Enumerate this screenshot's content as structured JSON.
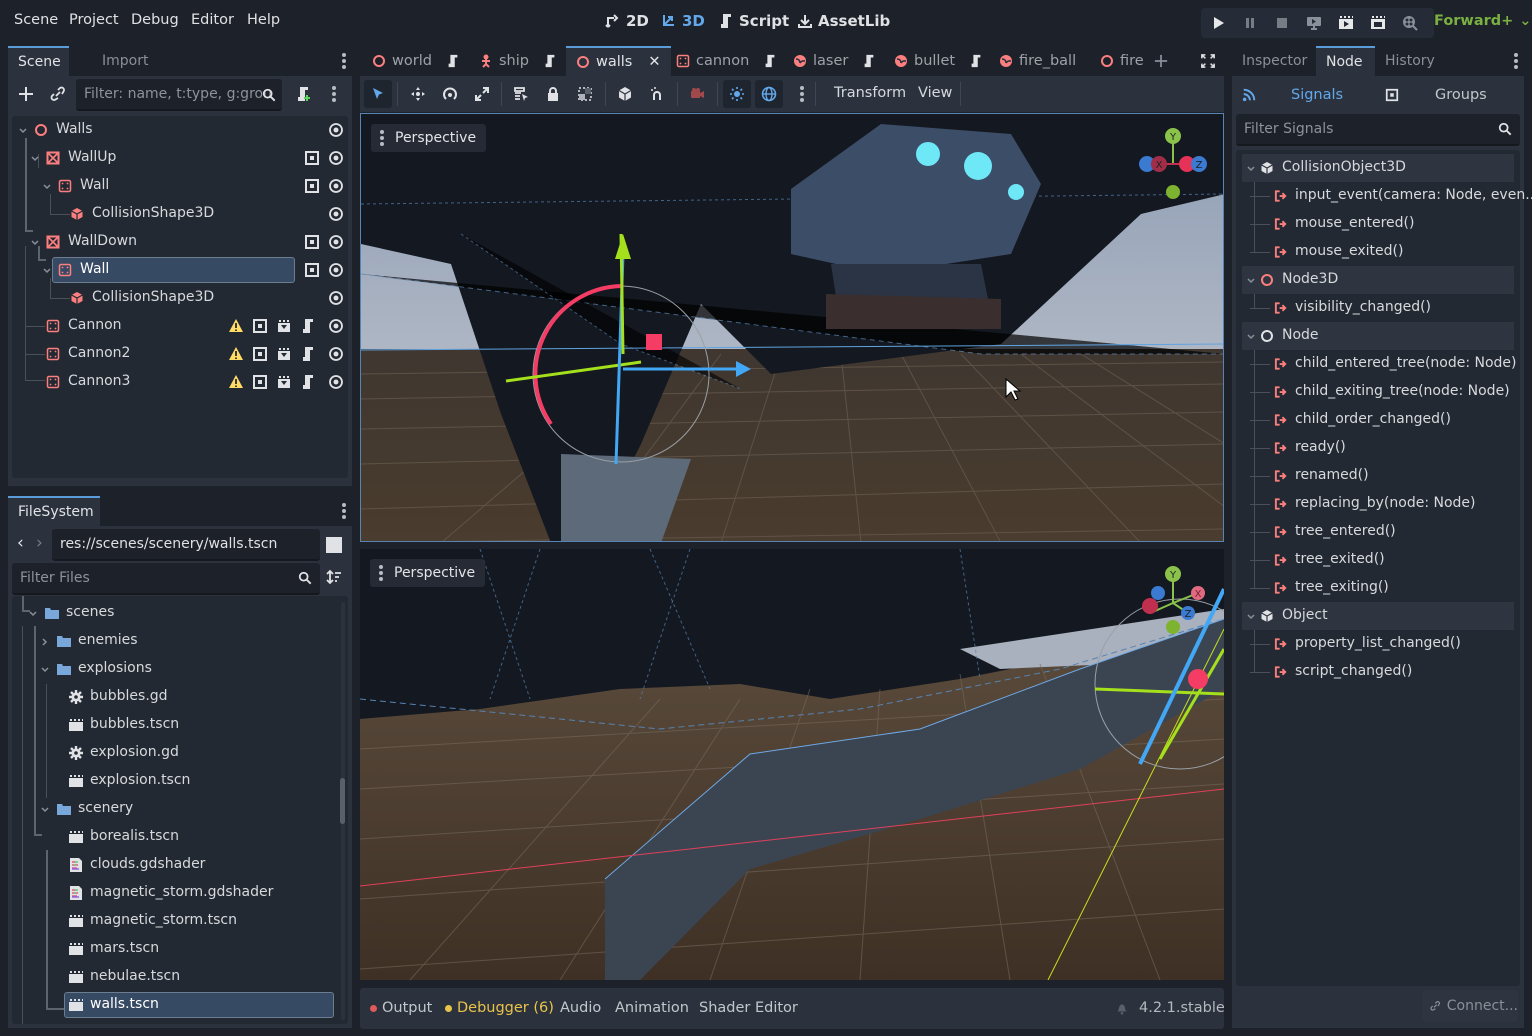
{
  "menubar": {
    "menus": [
      "Scene",
      "Project",
      "Debug",
      "Editor",
      "Help"
    ],
    "workspaces": [
      {
        "label": "2D",
        "icon": "2d-icon",
        "active": false
      },
      {
        "label": "3D",
        "icon": "3d-icon",
        "active": true
      },
      {
        "label": "Script",
        "icon": "script-icon",
        "active": false
      },
      {
        "label": "AssetLib",
        "icon": "download-icon",
        "active": false
      }
    ],
    "run_buttons": [
      "play-icon",
      "pause-icon",
      "stop-icon",
      "remote-debug-icon",
      "play-scene-icon",
      "play-custom-scene-icon",
      "movie-maker-icon"
    ],
    "renderer": "Forward+"
  },
  "scene_dock": {
    "tabs": [
      "Scene",
      "Import"
    ],
    "active_tab": "Scene",
    "filter_placeholder": "Filter: name, t:type, g:grou",
    "tree": [
      {
        "name": "Walls",
        "type": "node3d",
        "depth": 0,
        "expanded": true,
        "buttons": [
          "visibility"
        ]
      },
      {
        "name": "WallUp",
        "type": "static-body",
        "depth": 1,
        "expanded": true,
        "buttons": [
          "group",
          "visibility"
        ]
      },
      {
        "name": "Wall",
        "type": "area",
        "depth": 2,
        "expanded": true,
        "buttons": [
          "group",
          "visibility"
        ]
      },
      {
        "name": "CollisionShape3D",
        "type": "collision-shape",
        "depth": 3,
        "buttons": [
          "visibility"
        ]
      },
      {
        "name": "WallDown",
        "type": "static-body",
        "depth": 1,
        "expanded": true,
        "buttons": [
          "group",
          "visibility"
        ]
      },
      {
        "name": "Wall",
        "type": "area",
        "depth": 2,
        "expanded": true,
        "selected": true,
        "buttons": [
          "group",
          "visibility"
        ]
      },
      {
        "name": "CollisionShape3D",
        "type": "collision-shape",
        "depth": 3,
        "buttons": [
          "visibility"
        ]
      },
      {
        "name": "Cannon",
        "type": "area",
        "depth": 1,
        "buttons": [
          "warning",
          "group",
          "instance",
          "script",
          "visibility"
        ]
      },
      {
        "name": "Cannon2",
        "type": "area",
        "depth": 1,
        "buttons": [
          "warning",
          "group",
          "instance",
          "script",
          "visibility"
        ]
      },
      {
        "name": "Cannon3",
        "type": "area",
        "depth": 1,
        "buttons": [
          "warning",
          "group",
          "instance",
          "script",
          "visibility"
        ]
      }
    ]
  },
  "filesystem": {
    "tab": "FileSystem",
    "path": "res://scenes/scenery/walls.tscn",
    "filter_placeholder": "Filter Files",
    "items": [
      {
        "name": "scenes",
        "kind": "folder",
        "depth": 0,
        "expanded": true
      },
      {
        "name": "enemies",
        "kind": "folder",
        "depth": 1,
        "expanded": false
      },
      {
        "name": "explosions",
        "kind": "folder",
        "depth": 1,
        "expanded": true
      },
      {
        "name": "bubbles.gd",
        "kind": "script",
        "depth": 2
      },
      {
        "name": "bubbles.tscn",
        "kind": "scene",
        "depth": 2
      },
      {
        "name": "explosion.gd",
        "kind": "script",
        "depth": 2
      },
      {
        "name": "explosion.tscn",
        "kind": "scene",
        "depth": 2
      },
      {
        "name": "scenery",
        "kind": "folder",
        "depth": 1,
        "expanded": true
      },
      {
        "name": "borealis.tscn",
        "kind": "scene",
        "depth": 2
      },
      {
        "name": "clouds.gdshader",
        "kind": "shader",
        "depth": 2
      },
      {
        "name": "magnetic_storm.gdshader",
        "kind": "shader",
        "depth": 2
      },
      {
        "name": "magnetic_storm.tscn",
        "kind": "scene",
        "depth": 2
      },
      {
        "name": "mars.tscn",
        "kind": "scene",
        "depth": 2
      },
      {
        "name": "nebulae.tscn",
        "kind": "scene",
        "depth": 2
      },
      {
        "name": "walls.tscn",
        "kind": "scene",
        "depth": 2,
        "selected": true
      }
    ]
  },
  "scene_tabs": [
    {
      "label": "world",
      "icon": "node3d",
      "script": true
    },
    {
      "label": "ship",
      "icon": "character",
      "script": true
    },
    {
      "label": "walls",
      "icon": "node3d",
      "active": true,
      "closable": true
    },
    {
      "label": "cannon",
      "icon": "area",
      "script": true
    },
    {
      "label": "laser",
      "icon": "rigid",
      "script": true
    },
    {
      "label": "bullet",
      "icon": "rigid",
      "script": true
    },
    {
      "label": "fire_ball",
      "icon": "rigid",
      "script": false
    },
    {
      "label": "fire",
      "icon": "node3d",
      "script": false
    }
  ],
  "viewport_toolbar": {
    "tools": [
      "select",
      "move",
      "rotate",
      "scale",
      "list-select",
      "lock",
      "group",
      "local-space",
      "snap",
      "camera-preview",
      "sun",
      "environment",
      "more"
    ],
    "menus": [
      "Transform",
      "View"
    ]
  },
  "viewports": [
    {
      "label": "Perspective",
      "gizmo_axes": [
        "Y",
        "X",
        "Z"
      ]
    },
    {
      "label": "Perspective",
      "gizmo_axes": [
        "Y",
        "X",
        "Z"
      ]
    }
  ],
  "bottom_panel": {
    "tabs": [
      {
        "label": "Output",
        "dot": "#e05a5a"
      },
      {
        "label": "Debugger (6)",
        "dot": "#e8c44a",
        "highlight": true
      },
      {
        "label": "Audio"
      },
      {
        "label": "Animation"
      },
      {
        "label": "Shader Editor"
      }
    ],
    "version": "4.2.1.stable"
  },
  "node_dock": {
    "tabs": [
      "Inspector",
      "Node",
      "History"
    ],
    "active_tab": "Node",
    "subtabs": [
      "Signals",
      "Groups"
    ],
    "active_subtab": "Signals",
    "filter_placeholder": "Filter Signals",
    "categories": [
      {
        "name": "CollisionObject3D",
        "icon": "cube",
        "signals": [
          "input_event(camera: Node, even...",
          "mouse_entered()",
          "mouse_exited()"
        ]
      },
      {
        "name": "Node3D",
        "icon": "node3d",
        "signals": [
          "visibility_changed()"
        ]
      },
      {
        "name": "Node",
        "icon": "node",
        "signals": [
          "child_entered_tree(node: Node)",
          "child_exiting_tree(node: Node)",
          "child_order_changed()",
          "ready()",
          "renamed()",
          "replacing_by(node: Node)",
          "tree_entered()",
          "tree_exited()",
          "tree_exiting()"
        ]
      },
      {
        "name": "Object",
        "icon": "cube",
        "signals": [
          "property_list_changed()",
          "script_changed()"
        ]
      }
    ],
    "connect_label": "Connect..."
  },
  "colors": {
    "accent": "#5a9bd8",
    "node3d": "#fc7f7f",
    "renderer": "#79b041",
    "warning": "#ffdd65"
  }
}
